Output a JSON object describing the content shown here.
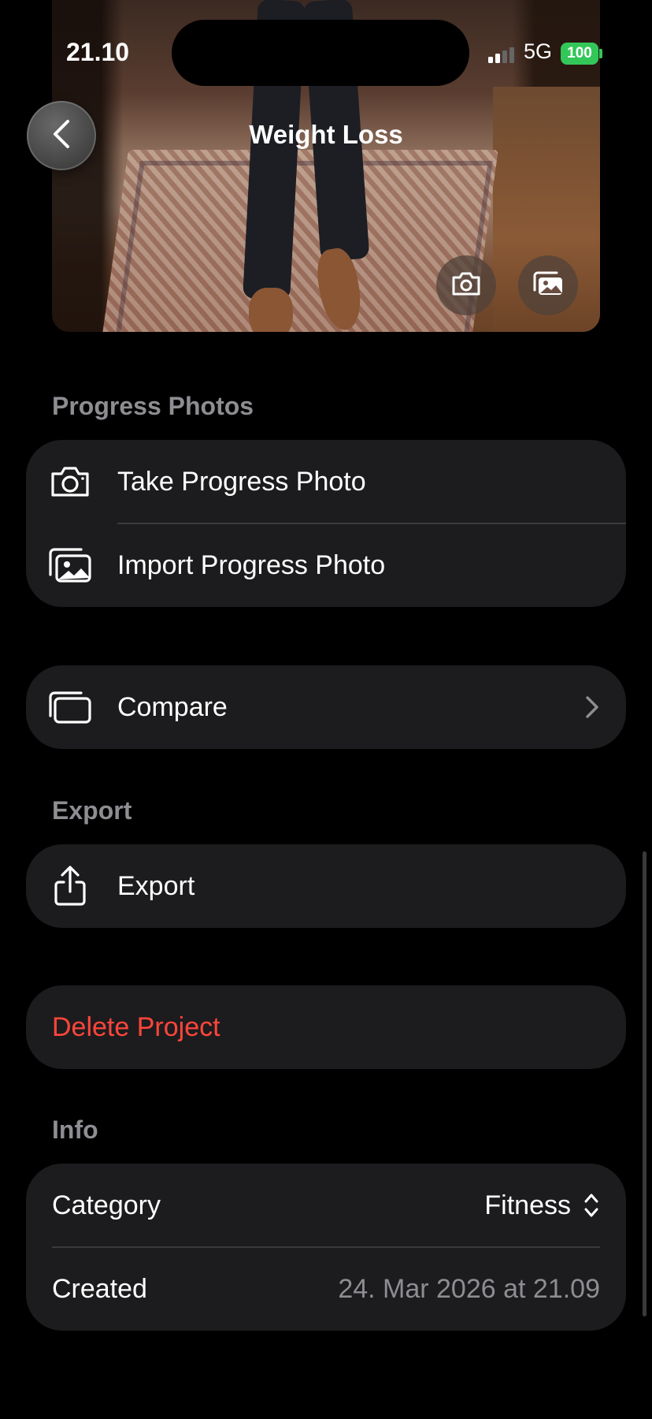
{
  "status_bar": {
    "time": "21.10",
    "network": "5G",
    "battery": "100"
  },
  "nav": {
    "title": "Weight Loss",
    "back_icon": "chevron-left-icon"
  },
  "hero": {
    "camera_icon": "camera-icon",
    "photos_icon": "photo-stack-icon"
  },
  "progress_photos": {
    "header": "Progress Photos",
    "take_label": "Take Progress Photo",
    "import_label": "Import Progress Photo"
  },
  "compare": {
    "label": "Compare"
  },
  "export": {
    "header": "Export",
    "label": "Export"
  },
  "delete": {
    "label": "Delete Project",
    "color": "#ff453a"
  },
  "info": {
    "header": "Info",
    "category_label": "Category",
    "category_value": "Fitness",
    "created_label": "Created",
    "created_value": "24. Mar 2026 at 21.09"
  },
  "colors": {
    "background": "#000000",
    "card": "#1c1c1e",
    "secondary_text": "#8d8d92",
    "battery": "#33c759"
  }
}
